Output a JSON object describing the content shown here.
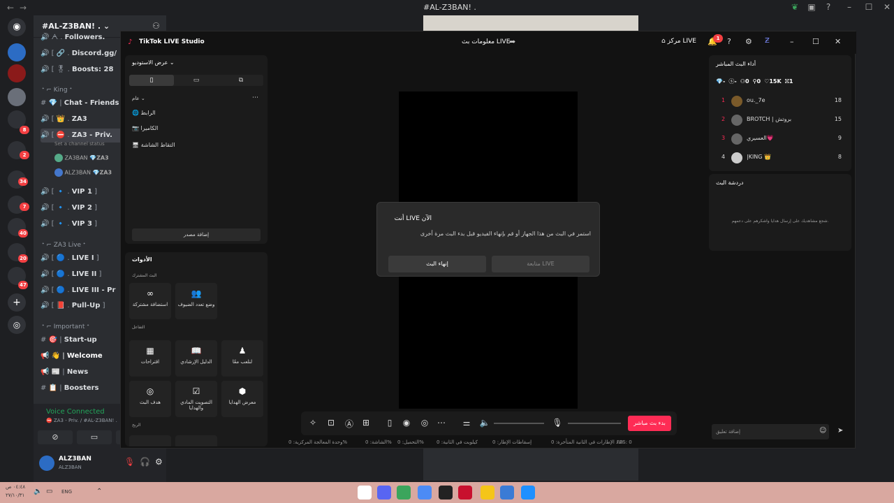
{
  "discord": {
    "window_title": "#AL-Z3BAN! .",
    "server_name": "#AL-Z3BAN! .",
    "rail_badges": [
      "8",
      "2",
      "34",
      "7",
      "40",
      "20",
      "47"
    ],
    "channels": [
      {
        "text": "Followers.",
        "prefix": "ᗅ"
      },
      {
        "text": "Discord.gg/",
        "prefix": "🔗 ."
      },
      {
        "text": "Boosts: 28",
        "prefix": "🎖 ."
      }
    ],
    "cat_king": "King",
    "king_channels": [
      {
        "text": "Chat - Friends",
        "prefix": "💎 ."
      },
      {
        "text": "ZA3",
        "prefix": "🏆 ."
      },
      {
        "text": "ZA3 - Priv.",
        "prefix": "⛔ ."
      }
    ],
    "channel_status": "Set a channel status",
    "voice_users": [
      {
        "name": "ZA3BAN",
        "tag": "ZA3"
      },
      {
        "name": "ALZ3BAN",
        "tag": "ZA3"
      }
    ],
    "vip_channels": [
      "VIP 1",
      "VIP 2",
      "VIP 3"
    ],
    "cat_live": "ZA3 Live",
    "live_channels": [
      "LIVE I",
      "LIVE II",
      "LIVE III - Pr",
      "Pull-Up"
    ],
    "cat_important": "Important",
    "important_channels": [
      "Start-up",
      "Welcome",
      "News",
      "Boosters"
    ],
    "voice_connected": "Voice Connected",
    "voice_path": "⛔ ZA3 - Priv. / #AL-Z3BAN! .",
    "user_name": "ALZ3BAN",
    "user_status": "ALZ3BAN"
  },
  "tiktok": {
    "app_title": "TikTok LIVE Studio",
    "center_title": "معلومات بث LIVE",
    "live_center": "مركز LIVE",
    "notif_count": "1",
    "studio_view": "عرض الاستوديو",
    "general": "عام",
    "sources": [
      "الرابط",
      "الكاميرا",
      "التقاط الشاشة"
    ],
    "add_source": "إضافة مصدر",
    "tools_title": "الأدوات",
    "cohost": "البث المشترك",
    "tool_guest": "استضافة مشتركة",
    "tool_multi": "وضع تعدد الضيوف",
    "interaction": "التفاعل",
    "tool_suggest": "اقتراحات",
    "tool_guide": "الدليل الإرشادي",
    "tool_play": "لنلعب معًا",
    "tool_goal": "هدف البث",
    "tool_poll": "التصويت المادي والهدايا",
    "tool_gift": "معرض الهدايا",
    "profit": "الربح",
    "modal_title": "أنت LIVE الآن",
    "modal_desc": "استمر في البث من هذا الجهاز أو قم بإنهاء الفيديو قبل بدء البث مرة أخرى",
    "modal_end": "إنهاء البث",
    "modal_continue": "متابعة LIVE",
    "go_live": "بدء بث مباشر",
    "stats": [
      "FPS: 0",
      "عدد الإطارات في الثانية المتأخرة: 0",
      "إسقاطات الإطار: 0",
      "كيلوبت في الثانية: 0",
      "التحميل: 0%",
      "الشاشة: 0%",
      "وحدة المعالجة المركزية: 0%"
    ],
    "perf_title": "أداء البث المباشر",
    "perf_stats": [
      "-",
      "-",
      "0",
      "0",
      "15K",
      "1"
    ],
    "ranking": [
      {
        "rank": "1",
        "name": "ou._7e",
        "score": "18"
      },
      {
        "rank": "2",
        "name": "BROTCH | بروتش",
        "score": "15"
      },
      {
        "rank": "3",
        "name": "العسيري💗",
        "score": "9"
      },
      {
        "rank": "4",
        "name": "|KING 👑",
        "score": "8"
      }
    ],
    "chat_title": "دردشة البث",
    "chat_empty": "شجع مشاهديك على إرسال هدايا واشكرهم على دعمهم.",
    "chat_placeholder": "إضافة تعليق"
  },
  "taskbar": {
    "time": "٠٤:٤٨ ص",
    "date": "٢٧/١٠/٣١",
    "lang": "ENG"
  }
}
